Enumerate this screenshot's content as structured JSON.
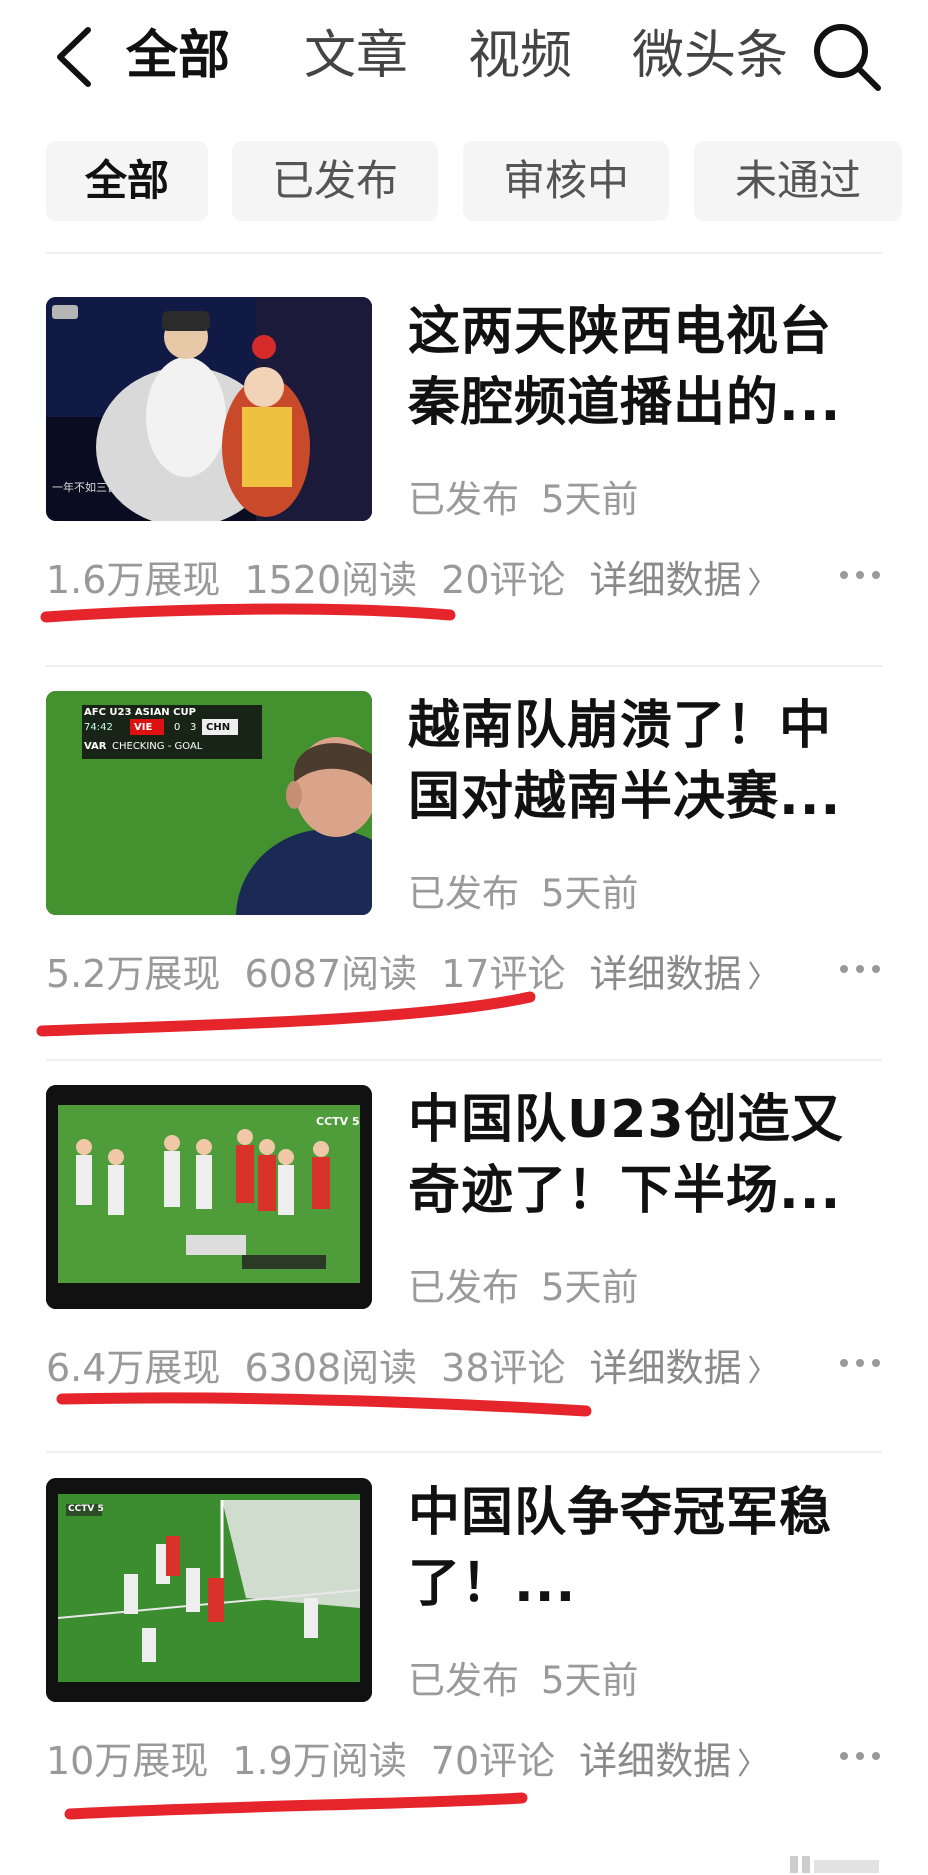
{
  "header": {
    "tabs": [
      {
        "label": "全部",
        "active": true
      },
      {
        "label": "文章"
      },
      {
        "label": "视频"
      },
      {
        "label": "微头条"
      }
    ]
  },
  "filters": [
    {
      "label": "全部",
      "active": true
    },
    {
      "label": "已发布"
    },
    {
      "label": "审核中"
    },
    {
      "label": "未通过"
    }
  ],
  "colors": {
    "annotation_red": "#e5242c",
    "chip_bg": "#f5f5f5",
    "muted_text": "#9a9a9a"
  },
  "articles": [
    {
      "title_line1": "这两天陕西电视台",
      "title_line2": "秦腔频道播出的...",
      "status": "已发布",
      "time": "5天前",
      "impressions": "1.6万展现",
      "reads": "1520阅读",
      "comments": "20评论",
      "detail_label": "详细数据",
      "thumb": {
        "caption": "一年不如三百六十天"
      }
    },
    {
      "title_line1": "越南队崩溃了！中",
      "title_line2": "国对越南半决赛...",
      "status": "已发布",
      "time": "5天前",
      "impressions": "5.2万展现",
      "reads": "6087阅读",
      "comments": "17评论",
      "detail_label": "详细数据",
      "thumb": {
        "league": "AFC U23 ASIAN CUP",
        "clock": "74:42",
        "home": "VIE",
        "home_score": "0",
        "away_score": "3",
        "away": "CHN",
        "var": "VAR",
        "var_text": "CHECKING - GOAL"
      }
    },
    {
      "title_line1": "中国队U23创造又",
      "title_line2": "奇迹了！下半场...",
      "status": "已发布",
      "time": "5天前",
      "impressions": "6.4万展现",
      "reads": "6308阅读",
      "comments": "38评论",
      "detail_label": "详细数据",
      "thumb": {
        "channel": "CCTV 5"
      }
    },
    {
      "title_line1": "中国队争夺冠军稳",
      "title_line2": "了！...",
      "status": "已发布",
      "time": "5天前",
      "impressions": "10万展现",
      "reads": "1.9万阅读",
      "comments": "70评论",
      "detail_label": "详细数据",
      "thumb": {
        "channel": "CCTV 5"
      }
    }
  ]
}
